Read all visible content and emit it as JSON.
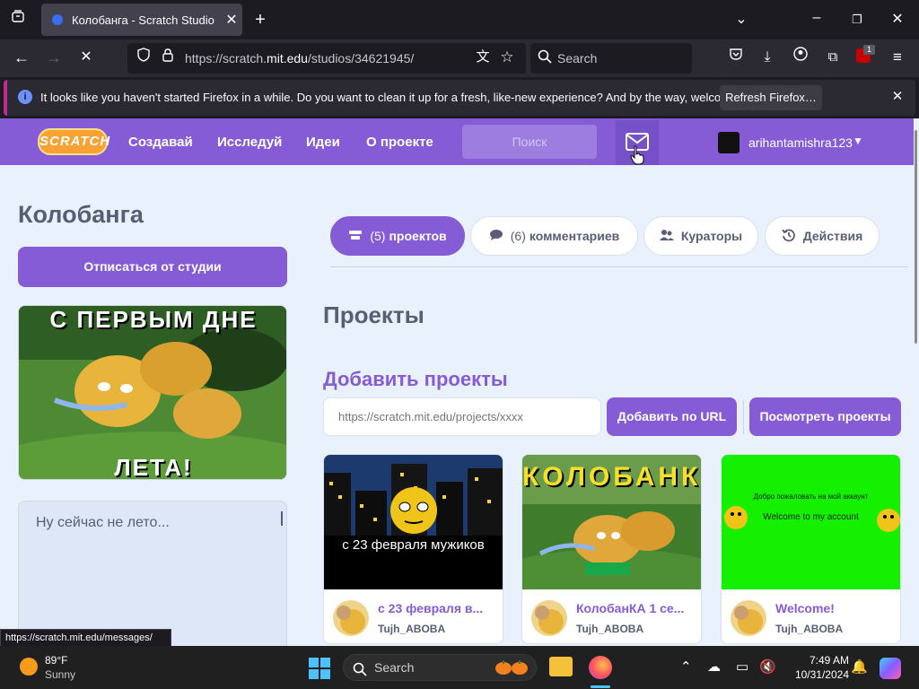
{
  "browser": {
    "tab_title": "Колобанга - Scratch Studio",
    "url_prefix": "https://scratch.",
    "url_domain": "mit.edu",
    "url_path": "/studios/34621945/",
    "search_placeholder": "Search",
    "extension_badge": "1"
  },
  "notification": {
    "text": "It looks like you haven't started Firefox in a while. Do you want to clean it up for a fresh, like-new experience? And by the way, welcome back!",
    "button_label": "Refresh Firefox…"
  },
  "scratch_nav": {
    "logo_text": "SCRATCH",
    "links": [
      "Создавай",
      "Исследуй",
      "Идеи",
      "О проекте"
    ],
    "search_placeholder": "Поиск",
    "username": "arihantamishra123"
  },
  "studio": {
    "title": "Колобанга",
    "unfollow_label": "Отписаться от студии",
    "thumb_top_text": "С ПЕРВЫМ ДНЕ",
    "thumb_bottom_text": "ЛЕТА!",
    "description": "Ну сейчас не лето..."
  },
  "tabs": {
    "projects_count": "(5)",
    "projects_label": "проектов",
    "comments_count": "(6)",
    "comments_label": "комментариев",
    "curators_label": "Кураторы",
    "activity_label": "Действия"
  },
  "main": {
    "projects_heading": "Проекты",
    "add_heading": "Добавить проекты",
    "url_placeholder": "https://scratch.mit.edu/projects/xxxx",
    "add_url_label": "Добавить по URL",
    "view_projects_label": "Посмотреть проекты"
  },
  "projects": [
    {
      "title": "с 23 февраля в...",
      "author": "Tujh_ABOBA",
      "thumb_text": "с 23 февраля мужиков"
    },
    {
      "title": "КолобанКА 1 се...",
      "author": "Tujh_ABOBA",
      "thumb_text": "КОЛОБАНКА"
    },
    {
      "title": "Welcome!",
      "author": "Tujh_ABOBA",
      "thumb_text_1": "Добро пожаловать на мой аккаунт",
      "thumb_text_2": "Welcome to my account"
    }
  ],
  "status_url": "https://scratch.mit.edu/messages/",
  "taskbar": {
    "temperature": "89°F",
    "condition": "Sunny",
    "search_label": "Search",
    "time": "7:49 AM",
    "date": "10/31/2024"
  },
  "colors": {
    "scratch_purple": "#855cd6",
    "text_gray": "#575e75",
    "page_bg": "#e9f1fc"
  }
}
